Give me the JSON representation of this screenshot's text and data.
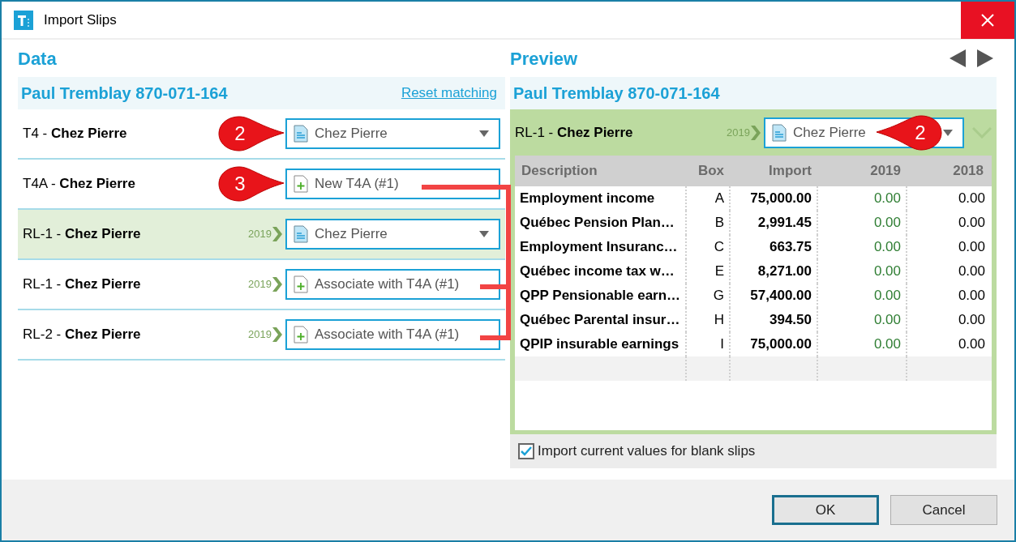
{
  "window": {
    "title": "Import Slips"
  },
  "data_panel": {
    "heading": "Data",
    "person": "Paul Tremblay 870-071-164",
    "reset_link": "Reset matching",
    "rows": [
      {
        "type": "T4 -",
        "name": "Chez Pierre",
        "selected": false,
        "match": {
          "kind": "existing",
          "label": "Chez Pierre",
          "dropdown": true
        },
        "callout": "2"
      },
      {
        "type": "T4A -",
        "name": "Chez Pierre",
        "selected": false,
        "match": {
          "kind": "new",
          "label": "New T4A (#1)",
          "dropdown": false
        },
        "callout": "3"
      },
      {
        "type": "RL-1 -",
        "name": "Chez Pierre",
        "year": "2019",
        "selected": true,
        "match": {
          "kind": "existing",
          "label": "Chez Pierre",
          "dropdown": true
        }
      },
      {
        "type": "RL-1 -",
        "name": "Chez Pierre",
        "year": "2019",
        "selected": false,
        "match": {
          "kind": "new",
          "label": "Associate with T4A (#1)",
          "dropdown": false
        }
      },
      {
        "type": "RL-2 -",
        "name": "Chez Pierre",
        "year": "2019",
        "selected": false,
        "match": {
          "kind": "new",
          "label": "Associate with T4A (#1)",
          "dropdown": false
        }
      }
    ]
  },
  "preview_panel": {
    "heading": "Preview",
    "person": "Paul Tremblay 870-071-164",
    "slip": {
      "type": "RL-1 -",
      "name": "Chez Pierre",
      "year": "2019",
      "match": {
        "kind": "existing",
        "label": "Chez Pierre",
        "dropdown": true
      },
      "callout": "2"
    },
    "table": {
      "columns": [
        "Description",
        "Box",
        "Import",
        "2019",
        "2018"
      ],
      "rows": [
        [
          "Employment income",
          "A",
          "75,000.00",
          "0.00",
          "0.00"
        ],
        [
          "Québec Pension Plan…",
          "B",
          "2,991.45",
          "0.00",
          "0.00"
        ],
        [
          "Employment Insuranc…",
          "C",
          "663.75",
          "0.00",
          "0.00"
        ],
        [
          "Québec income tax w…",
          "E",
          "8,271.00",
          "0.00",
          "0.00"
        ],
        [
          "QPP Pensionable earn…",
          "G",
          "57,400.00",
          "0.00",
          "0.00"
        ],
        [
          "Québec Parental insur…",
          "H",
          "394.50",
          "0.00",
          "0.00"
        ],
        [
          "QPIP insurable earnings",
          "I",
          "75,000.00",
          "0.00",
          "0.00"
        ]
      ]
    },
    "import_blank": {
      "label": "Import current values for blank slips",
      "checked": true
    }
  },
  "buttons": [
    {
      "label": "OK",
      "default": true
    },
    {
      "label": "Cancel",
      "default": false
    }
  ]
}
